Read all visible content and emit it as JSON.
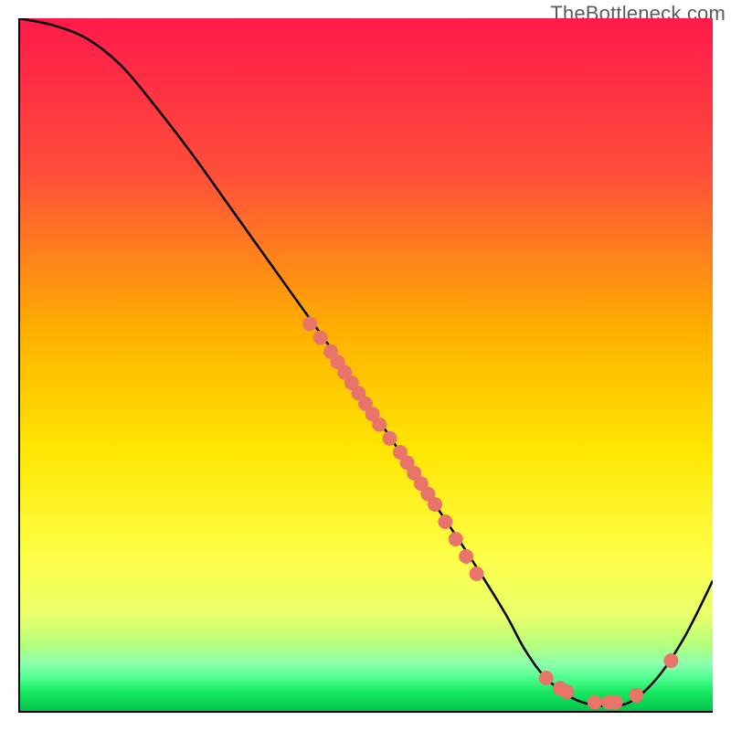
{
  "watermark": "TheBottleneck.com",
  "chart_data": {
    "type": "line",
    "title": "",
    "xlabel": "",
    "ylabel": "",
    "xlim": [
      0,
      100
    ],
    "ylim": [
      0,
      100
    ],
    "x": [
      0,
      5,
      10,
      15,
      20,
      25,
      30,
      35,
      40,
      45,
      50,
      55,
      60,
      65,
      70,
      73,
      76,
      80,
      84,
      88,
      92,
      96,
      100
    ],
    "values": [
      100,
      99,
      97,
      93,
      87,
      80.5,
      73.5,
      66.5,
      59.5,
      52.5,
      45,
      37.5,
      30,
      22.5,
      14.5,
      9,
      5,
      2,
      1,
      1.5,
      5,
      11,
      19
    ],
    "scatter_points": [
      {
        "x": 42,
        "y": 56
      },
      {
        "x": 43.5,
        "y": 54
      },
      {
        "x": 45,
        "y": 52
      },
      {
        "x": 46,
        "y": 50.5
      },
      {
        "x": 47,
        "y": 49
      },
      {
        "x": 48,
        "y": 47.5
      },
      {
        "x": 49,
        "y": 46
      },
      {
        "x": 50,
        "y": 44.5
      },
      {
        "x": 51,
        "y": 43
      },
      {
        "x": 52,
        "y": 41.5
      },
      {
        "x": 53.5,
        "y": 39.5
      },
      {
        "x": 55,
        "y": 37.5
      },
      {
        "x": 56,
        "y": 36
      },
      {
        "x": 57,
        "y": 34.5
      },
      {
        "x": 58,
        "y": 33
      },
      {
        "x": 59,
        "y": 31.5
      },
      {
        "x": 60,
        "y": 30
      },
      {
        "x": 61.5,
        "y": 27.5
      },
      {
        "x": 63,
        "y": 25
      },
      {
        "x": 64.5,
        "y": 22.5
      },
      {
        "x": 66,
        "y": 20
      },
      {
        "x": 76,
        "y": 5
      },
      {
        "x": 78,
        "y": 3.5
      },
      {
        "x": 79,
        "y": 3
      },
      {
        "x": 83,
        "y": 1.5
      },
      {
        "x": 85,
        "y": 1.5
      },
      {
        "x": 86,
        "y": 1.5
      },
      {
        "x": 89,
        "y": 2.5
      },
      {
        "x": 94,
        "y": 7.5
      }
    ],
    "gradient_stops": [
      {
        "offset": 0,
        "color": "#ff1a4a"
      },
      {
        "offset": 22,
        "color": "#ff4d3a"
      },
      {
        "offset": 45,
        "color": "#ffb000"
      },
      {
        "offset": 62,
        "color": "#ffe600"
      },
      {
        "offset": 78,
        "color": "#fdff4a"
      },
      {
        "offset": 86,
        "color": "#e9ff6a"
      },
      {
        "offset": 90,
        "color": "#b6ff7a"
      },
      {
        "offset": 93,
        "color": "#8cffb0"
      },
      {
        "offset": 95,
        "color": "#4fff90"
      },
      {
        "offset": 97,
        "color": "#17e860"
      },
      {
        "offset": 100,
        "color": "#00c24a"
      }
    ],
    "curve_color": "#000000",
    "point_color": "#e8746a",
    "point_radius": 8
  }
}
